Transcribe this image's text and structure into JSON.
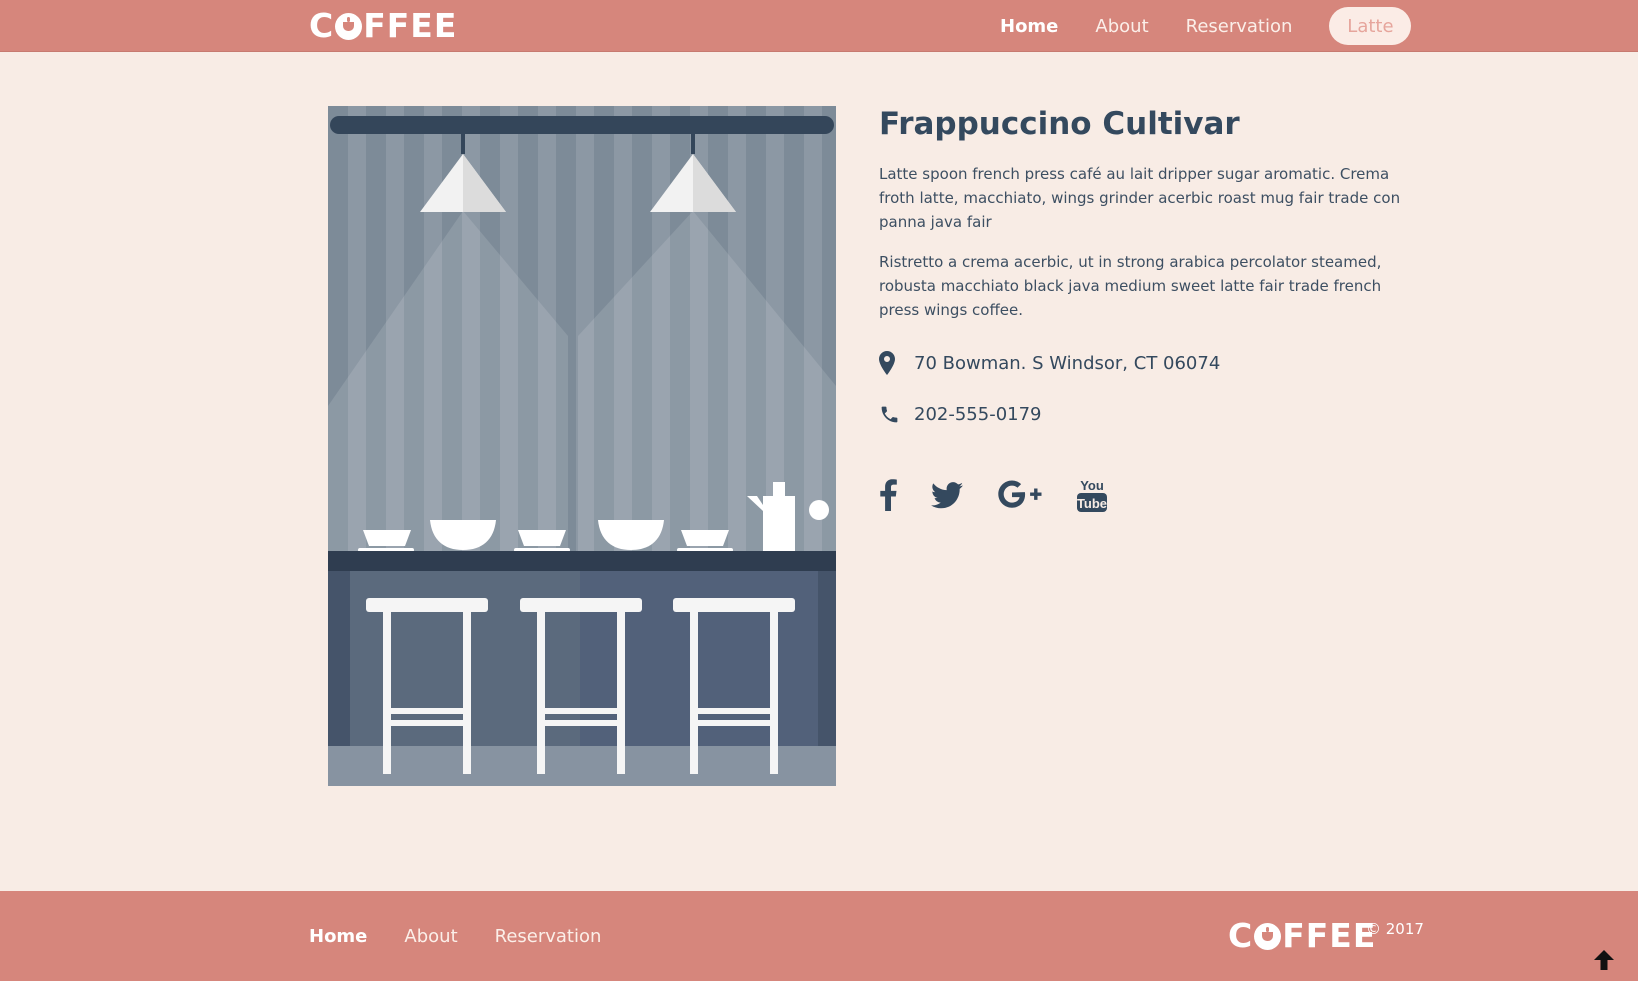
{
  "header": {
    "logo": {
      "prefix": "C",
      "suffix": "FFEE"
    },
    "nav": [
      {
        "label": "Home",
        "active": true
      },
      {
        "label": "About",
        "active": false
      },
      {
        "label": "Reservation",
        "active": false
      }
    ],
    "button_label": "Latte"
  },
  "main": {
    "image_icon": "coffee-bar-illustration",
    "title": "Frappuccino Cultivar",
    "paragraphs": [
      "Latte spoon french press café au lait dripper sugar aromatic. Crema froth latte, macchiato, wings grinder acerbic roast mug fair trade con panna java fair",
      "Ristretto a crema acerbic, ut in strong arabica percolator steamed, robusta macchiato black java medium sweet latte fair trade french press wings coffee."
    ],
    "address": {
      "icon": "map-marker-icon",
      "text": "70 Bowman. S Windsor, CT 06074"
    },
    "phone": {
      "icon": "phone-icon",
      "text": "202-555-0179"
    },
    "social": [
      "facebook-icon",
      "twitter-icon",
      "google-plus-icon",
      "youtube-icon"
    ]
  },
  "footer": {
    "nav": [
      {
        "label": "Home",
        "active": true
      },
      {
        "label": "About",
        "active": false
      },
      {
        "label": "Reservation",
        "active": false
      }
    ],
    "logo": {
      "prefix": "C",
      "suffix": "FFEE"
    },
    "copyright": "© 2017",
    "back_to_top_icon": "arrow-up-icon"
  },
  "colors": {
    "bar": "#d6867c",
    "background": "#f8ece5",
    "text": "#34495e"
  }
}
